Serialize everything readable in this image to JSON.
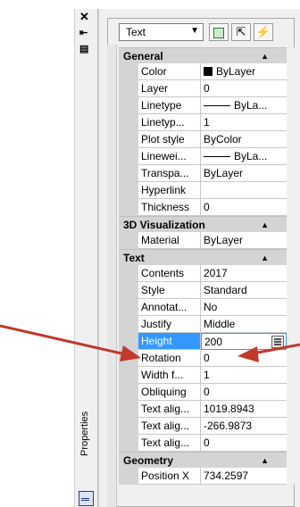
{
  "strip": {
    "close_glyph": "✕",
    "properties_label": "Properties"
  },
  "toolbar": {
    "object_type": "Text"
  },
  "categories": [
    {
      "name": "General",
      "rows": [
        {
          "label": "Color",
          "value": "ByLayer"
        },
        {
          "label": "Layer",
          "value": "0"
        },
        {
          "label": "Linetype",
          "value": "ByLa..."
        },
        {
          "label": "Linetyp...",
          "value": "1"
        },
        {
          "label": "Plot style",
          "value": "ByColor"
        },
        {
          "label": "Linewei...",
          "value": "ByLa..."
        },
        {
          "label": "Transpa...",
          "value": "ByLayer"
        },
        {
          "label": "Hyperlink",
          "value": ""
        },
        {
          "label": "Thickness",
          "value": "0"
        }
      ]
    },
    {
      "name": "3D Visualization",
      "rows": [
        {
          "label": "Material",
          "value": "ByLayer"
        }
      ]
    },
    {
      "name": "Text",
      "rows": [
        {
          "label": "Contents",
          "value": "2017"
        },
        {
          "label": "Style",
          "value": "Standard"
        },
        {
          "label": "Annotat...",
          "value": "No"
        },
        {
          "label": "Justify",
          "value": "Middle"
        },
        {
          "label": "Height",
          "value": "200"
        },
        {
          "label": "Rotation",
          "value": "0"
        },
        {
          "label": "Width f...",
          "value": "1"
        },
        {
          "label": "Obliquing",
          "value": "0"
        },
        {
          "label": "Text alig...",
          "value": "1019.8943"
        },
        {
          "label": "Text alig...",
          "value": "-266.9873"
        },
        {
          "label": "Text alig...",
          "value": "0"
        }
      ]
    },
    {
      "name": "Geometry",
      "rows": [
        {
          "label": "Position X",
          "value": "734.2597"
        }
      ]
    }
  ],
  "colors": {
    "selection": "#3399ff",
    "annotation_arrow": "#c0392b"
  }
}
